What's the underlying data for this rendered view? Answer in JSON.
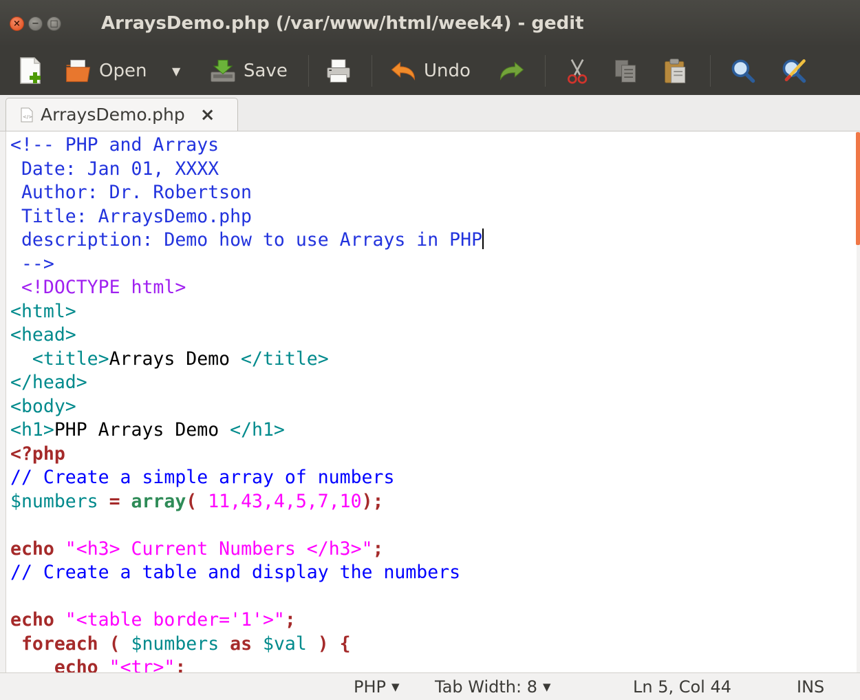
{
  "window": {
    "title": "ArraysDemo.php (/var/www/html/week4) - gedit"
  },
  "toolbar": {
    "open_label": "Open",
    "save_label": "Save",
    "undo_label": "Undo"
  },
  "tab": {
    "label": "ArraysDemo.php",
    "close": "×"
  },
  "editor": {
    "lines": [
      [
        {
          "t": "<!-- PHP and Arrays",
          "c": "#2233dd"
        }
      ],
      [
        {
          "t": " Date: Jan 01, XXXX",
          "c": "#2233dd"
        }
      ],
      [
        {
          "t": " Author: Dr. Robertson",
          "c": "#2233dd"
        }
      ],
      [
        {
          "t": " Title: ArraysDemo.php",
          "c": "#2233dd"
        }
      ],
      [
        {
          "t": " description: Demo how to use Arrays in PHP",
          "c": "#2233dd"
        },
        {
          "caret": true
        }
      ],
      [
        {
          "t": " -->",
          "c": "#2233dd"
        }
      ],
      [
        {
          "t": " <!DOCTYPE html>",
          "c": "#a020f0"
        }
      ],
      [
        {
          "t": "<html>",
          "c": "#008a8c"
        }
      ],
      [
        {
          "t": "<head>",
          "c": "#008a8c"
        }
      ],
      [
        {
          "t": "  <title>",
          "c": "#008a8c"
        },
        {
          "t": "Arrays Demo ",
          "c": "#000000"
        },
        {
          "t": "</title>",
          "c": "#008a8c"
        }
      ],
      [
        {
          "t": "</head>",
          "c": "#008a8c"
        }
      ],
      [
        {
          "t": "<body>",
          "c": "#008a8c"
        }
      ],
      [
        {
          "t": "<h1>",
          "c": "#008a8c"
        },
        {
          "t": "PHP Arrays Demo ",
          "c": "#000000"
        },
        {
          "t": "</h1>",
          "c": "#008a8c"
        }
      ],
      [
        {
          "t": "<?php",
          "c": "#a52a2a",
          "b": true
        }
      ],
      [
        {
          "t": "// Create a simple array of numbers",
          "c": "#0000ff"
        }
      ],
      [
        {
          "t": "$numbers",
          "c": "#008a8c"
        },
        {
          "t": " = ",
          "c": "#a52a2a",
          "b": true
        },
        {
          "t": "array",
          "c": "#2e8b57",
          "b": true
        },
        {
          "t": "( ",
          "c": "#a52a2a",
          "b": true
        },
        {
          "t": "11,43,4,5,7,10",
          "c": "#ff00ff"
        },
        {
          "t": ");",
          "c": "#a52a2a",
          "b": true
        }
      ],
      [
        {
          "t": " ",
          "c": "#000000"
        }
      ],
      [
        {
          "t": "echo",
          "c": "#a52a2a",
          "b": true
        },
        {
          "t": " ",
          "c": "#000000"
        },
        {
          "t": "\"<h3> Current Numbers </h3>\"",
          "c": "#ff00ff"
        },
        {
          "t": ";",
          "c": "#a52a2a",
          "b": true
        }
      ],
      [
        {
          "t": "// Create a table and display the numbers",
          "c": "#0000ff"
        }
      ],
      [
        {
          "t": " ",
          "c": "#000000"
        }
      ],
      [
        {
          "t": "echo",
          "c": "#a52a2a",
          "b": true
        },
        {
          "t": " ",
          "c": "#000000"
        },
        {
          "t": "\"<table border='1'>\"",
          "c": "#ff00ff"
        },
        {
          "t": ";",
          "c": "#a52a2a",
          "b": true
        }
      ],
      [
        {
          "t": " foreach",
          "c": "#a52a2a",
          "b": true
        },
        {
          "t": " ( ",
          "c": "#a52a2a",
          "b": true
        },
        {
          "t": "$numbers",
          "c": "#008a8c"
        },
        {
          "t": " as ",
          "c": "#a52a2a",
          "b": true
        },
        {
          "t": "$val",
          "c": "#008a8c"
        },
        {
          "t": " ) {",
          "c": "#a52a2a",
          "b": true
        }
      ],
      [
        {
          "t": "    echo",
          "c": "#a52a2a",
          "b": true
        },
        {
          "t": " ",
          "c": "#000000"
        },
        {
          "t": "\"<tr>\"",
          "c": "#ff00ff"
        },
        {
          "t": ";",
          "c": "#a52a2a",
          "b": true
        }
      ]
    ]
  },
  "statusbar": {
    "language": "PHP",
    "tab_width": "Tab Width: 8",
    "position": "Ln 5, Col 44",
    "mode": "INS"
  },
  "icons": {
    "new": "new-document-icon",
    "open": "open-folder-icon",
    "save": "save-icon",
    "print": "print-icon",
    "undo": "undo-icon",
    "redo": "redo-icon",
    "cut": "cut-icon",
    "copy": "copy-icon",
    "paste": "paste-icon",
    "search": "search-icon",
    "replace": "search-replace-icon"
  },
  "colors": {
    "titlebar": "#3c3b37",
    "accent": "#f07746"
  }
}
